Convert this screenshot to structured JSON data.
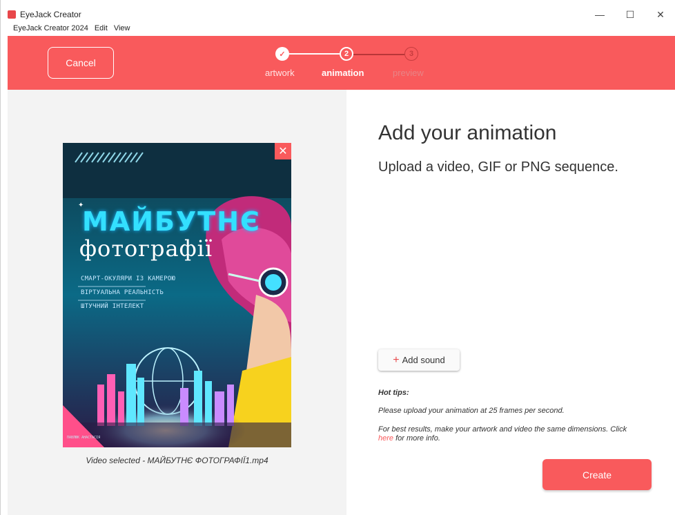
{
  "window": {
    "title": "EyeJack Creator",
    "controls": {
      "minimize": "—",
      "maximize": "☐",
      "close": "✕"
    }
  },
  "menu": [
    "EyeJack Creator 2024",
    "Edit",
    "View"
  ],
  "header": {
    "cancel_label": "Cancel",
    "steps": [
      {
        "number": "✓",
        "label": "artwork",
        "state": "done"
      },
      {
        "number": "2",
        "label": "animation",
        "state": "active"
      },
      {
        "number": "3",
        "label": "preview",
        "state": "upcoming"
      }
    ]
  },
  "artwork": {
    "close_icon": "✕",
    "poster_title_line1": "МАЙБУТНЄ",
    "poster_title_line2": "фотографії",
    "poster_lines": [
      "СМАРТ-ОКУЛЯРИ ІЗ КАМЕРОЮ",
      "ВІРТУАЛЬНА РЕАЛЬНІСТЬ",
      "ШТУЧНИЙ ІНТЕЛЕКТ"
    ],
    "poster_footer": "ПАВЛЮК АНАСТАСІЯ",
    "video_caption": "Video selected - МАЙБУТНЄ ФОТОГРАФІЇ1.mp4"
  },
  "panel": {
    "heading": "Add your animation",
    "subheading": "Upload a video, GIF or PNG sequence.",
    "add_sound": {
      "plus": "+",
      "label": "Add sound"
    },
    "tips_title": "Hot tips:",
    "tip1": "Please upload your animation at 25 frames per second.",
    "tip2_before": "For best results, make your artwork and video the same dimensions. Click ",
    "tip2_link": "here",
    "tip2_after": " for more info.",
    "create_label": "Create"
  },
  "colors": {
    "brand": "#f95a5c",
    "panel_bg": "#f3f3f3"
  }
}
